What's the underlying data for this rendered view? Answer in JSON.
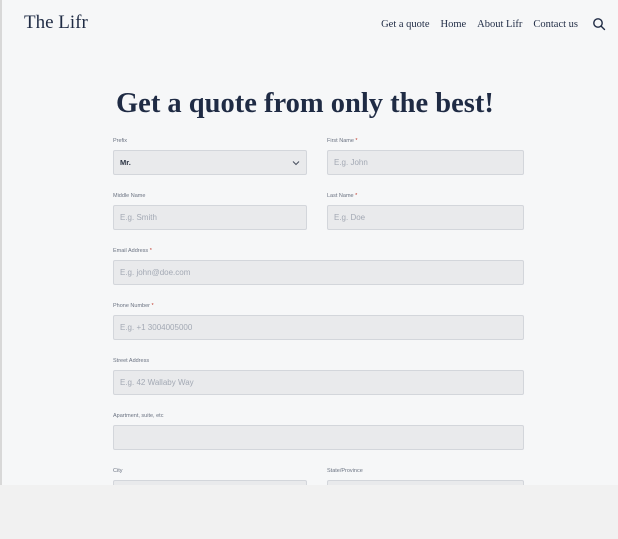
{
  "header": {
    "brand": "The Lifr",
    "nav": [
      {
        "label": "Get a quote"
      },
      {
        "label": "Home"
      },
      {
        "label": "About Lifr"
      },
      {
        "label": "Contact us"
      }
    ],
    "search_icon": "search-icon"
  },
  "title": "Get a quote from only the best!",
  "form": {
    "prefix": {
      "label": "Prefix",
      "value": "Mr."
    },
    "first_name": {
      "label": "First Name",
      "required": "*",
      "placeholder": "E.g. John"
    },
    "middle_name": {
      "label": "Middle Name",
      "placeholder": "E.g. Smith"
    },
    "last_name": {
      "label": "Last Name",
      "required": "*",
      "placeholder": "E.g. Doe"
    },
    "email": {
      "label": "Email Address",
      "required": "*",
      "placeholder": "E.g. john@doe.com"
    },
    "phone": {
      "label": "Phone Number",
      "required": "*",
      "placeholder": "E.g. +1 3004005000"
    },
    "street": {
      "label": "Street Address",
      "placeholder": "E.g. 42 Wallaby Way"
    },
    "apartment": {
      "label": "Apartment, suite, etc",
      "placeholder": ""
    },
    "city": {
      "label": "City",
      "placeholder": ""
    },
    "state": {
      "label": "State/Province",
      "placeholder": ""
    }
  },
  "colors": {
    "text": "#1f2b44",
    "input_bg": "#e9eaec",
    "required": "#c0392b"
  }
}
